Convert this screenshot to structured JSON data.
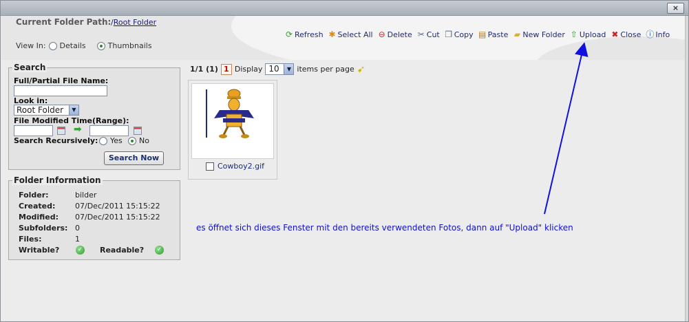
{
  "window": {
    "close_glyph": "×"
  },
  "header": {
    "path_label": "Current Folder Path:",
    "path_prefix": "/",
    "path_link": "Root Folder",
    "view_in_label": "View In:",
    "view_options": [
      "Details",
      "Thumbnails"
    ],
    "view_selected": "Thumbnails"
  },
  "toolbar": [
    {
      "label": "Refresh",
      "icon": "refresh-icon",
      "color": "#3a9a3a"
    },
    {
      "label": "Select All",
      "icon": "select-all-icon",
      "color": "#e08a10"
    },
    {
      "label": "Delete",
      "icon": "delete-icon",
      "color": "#d02020"
    },
    {
      "label": "Cut",
      "icon": "scissors-icon",
      "color": "#5a6a8a"
    },
    {
      "label": "Copy",
      "icon": "copy-icon",
      "color": "#4a6aa0"
    },
    {
      "label": "Paste",
      "icon": "paste-icon",
      "color": "#b07a30"
    },
    {
      "label": "New Folder",
      "icon": "new-folder-icon",
      "color": "#d8b030"
    },
    {
      "label": "Upload",
      "icon": "upload-icon",
      "color": "#3a9a3a"
    },
    {
      "label": "Close",
      "icon": "close-icon",
      "color": "#d02020"
    },
    {
      "label": "Info",
      "icon": "info-icon",
      "color": "#2a5ab0"
    }
  ],
  "search": {
    "title": "Search",
    "file_name_label": "Full/Partial File Name:",
    "file_name_value": "",
    "look_in_label": "Look in:",
    "look_in_value": "Root Folder",
    "modified_label": "File Modified Time(Range):",
    "from_value": "",
    "to_value": "",
    "recursive_label": "Search Recursively:",
    "recursive_options": [
      "Yes",
      "No"
    ],
    "recursive_selected": "No",
    "button": "Search Now"
  },
  "folder_info": {
    "title": "Folder Information",
    "rows": [
      {
        "key": "Folder:",
        "value": "bilder"
      },
      {
        "key": "Created:",
        "value": "07/Dec/2011 15:15:22"
      },
      {
        "key": "Modified:",
        "value": "07/Dec/2011 15:15:22"
      },
      {
        "key": "Subfolders:",
        "value": "0"
      },
      {
        "key": "Files:",
        "value": "1"
      }
    ],
    "writable_label": "Writable?",
    "readable_label": "Readable?"
  },
  "pager": {
    "count": "1/1 (1)",
    "current_page": "1",
    "display_label": "Display",
    "per_page_value": "10",
    "per_page_suffix": "items per page"
  },
  "files": [
    {
      "name": "Cowboy2.gif"
    }
  ],
  "annotation": "es öffnet sich dieses Fenster mit den bereits verwendeten Fotos, dann auf \"Upload\" klicken",
  "annotation_color": "#1010c8"
}
